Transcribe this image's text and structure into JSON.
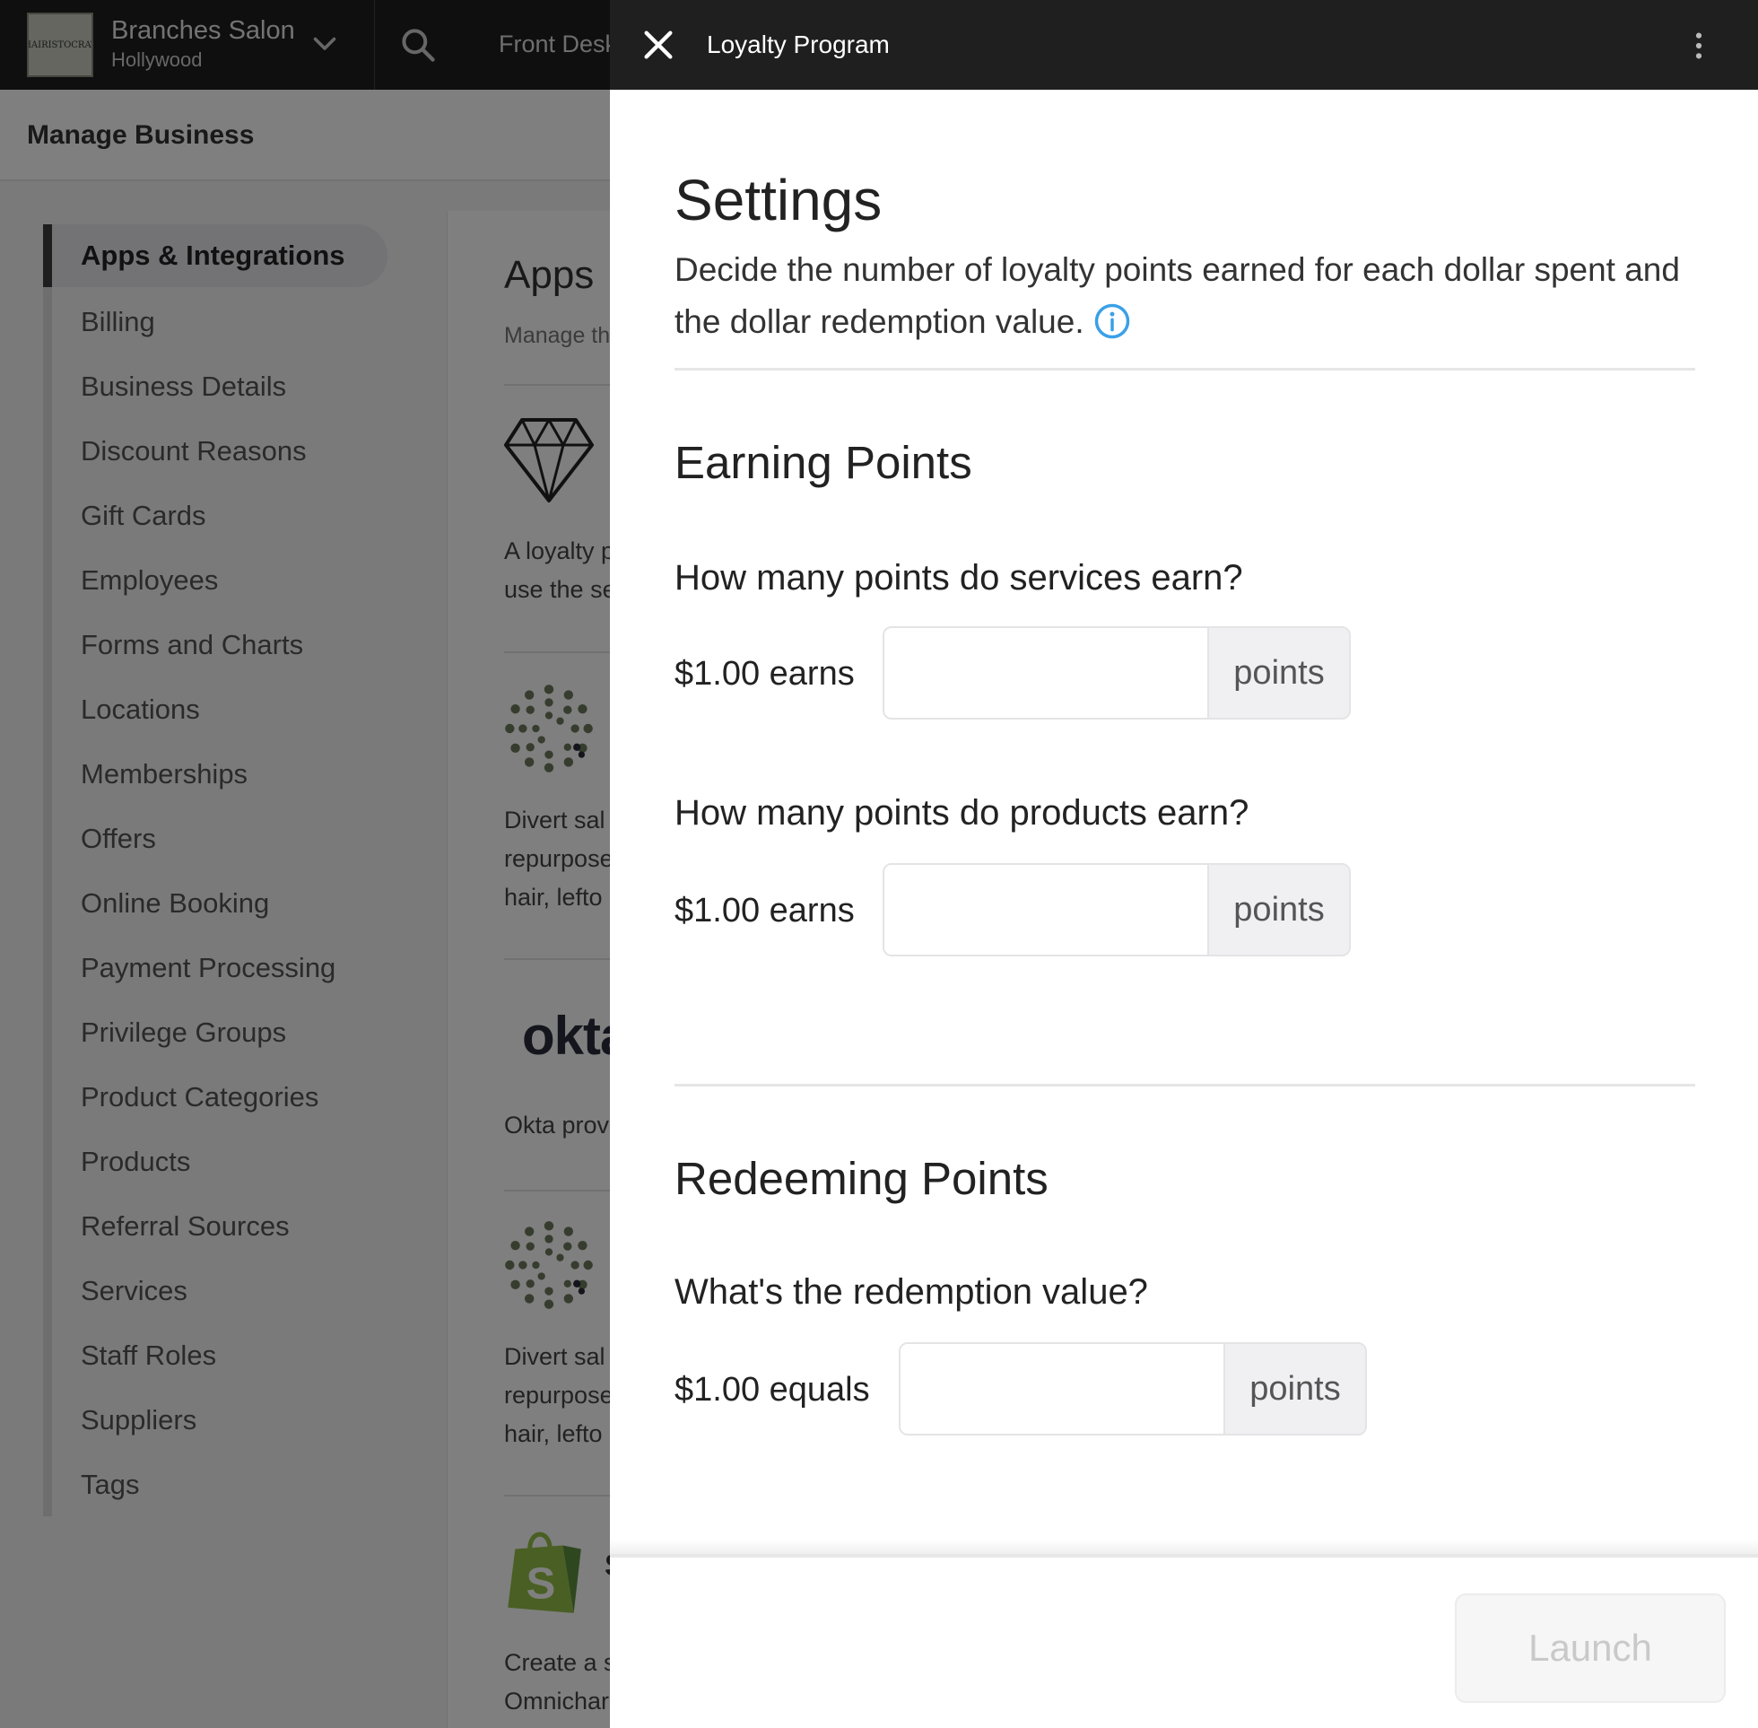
{
  "app": {
    "brand_name": "Branches Salon",
    "brand_location": "Hollywood",
    "logo_text": "HAIRISTOCRAT",
    "front_desk_label": "Front Desk"
  },
  "subheader": {
    "title": "Manage Business"
  },
  "sidebar": {
    "items": [
      {
        "label": "Apps & Integrations",
        "active": true
      },
      {
        "label": "Billing"
      },
      {
        "label": "Business Details"
      },
      {
        "label": "Discount Reasons"
      },
      {
        "label": "Gift Cards"
      },
      {
        "label": "Employees"
      },
      {
        "label": "Forms and Charts"
      },
      {
        "label": "Locations"
      },
      {
        "label": "Memberships"
      },
      {
        "label": "Offers"
      },
      {
        "label": "Online Booking"
      },
      {
        "label": "Payment Processing"
      },
      {
        "label": "Privilege Groups"
      },
      {
        "label": "Product Categories"
      },
      {
        "label": "Products"
      },
      {
        "label": "Referral Sources"
      },
      {
        "label": "Services"
      },
      {
        "label": "Staff Roles"
      },
      {
        "label": "Suppliers"
      },
      {
        "label": "Tags"
      }
    ]
  },
  "apps_panel": {
    "title": "Apps",
    "subtitle": "Manage th",
    "loyalty_desc_1": "A loyalty p",
    "loyalty_desc_2": "use the se",
    "divert_desc_1": "Divert sal",
    "divert_desc_2": "repurpose",
    "divert_desc_3": "hair, lefto",
    "okta_logo": "okta",
    "okta_desc": "Okta prov",
    "divert2_desc_1": "Divert sal",
    "divert2_desc_2": "repurpose",
    "divert2_desc_3": "hair, lefto",
    "shopify_s": "S",
    "shopify_desc_1": "Create a s",
    "shopify_desc_2": "Omnichar"
  },
  "drawer": {
    "title": "Loyalty Program",
    "settings_heading": "Settings",
    "settings_description": "Decide the number of loyalty points earned for each dollar spent and the dollar redemption value.",
    "earning": {
      "heading": "Earning Points",
      "services_question": "How many points do services earn?",
      "services_label": "$1.00 earns",
      "services_value": "",
      "services_unit": "points",
      "products_question": "How many points do products earn?",
      "products_label": "$1.00 earns",
      "products_value": "",
      "products_unit": "points"
    },
    "redeeming": {
      "heading": "Redeeming Points",
      "question": "What's the redemption value?",
      "label": "$1.00 equals",
      "value": "",
      "unit": "points"
    },
    "launch_label": "Launch"
  },
  "colors": {
    "header_bg": "#1f1f1f",
    "info_accent": "#3aa0e8",
    "overlay": "rgba(0,0,0,0.5)"
  }
}
